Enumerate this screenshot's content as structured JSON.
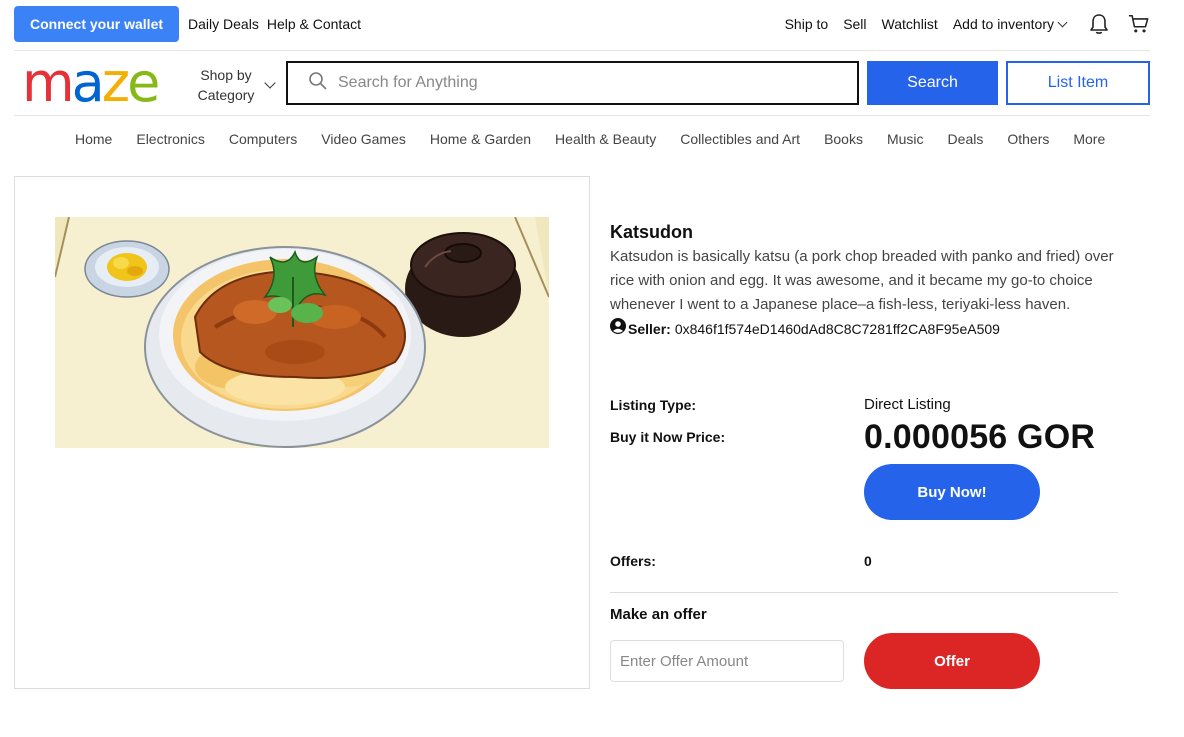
{
  "topbar": {
    "wallet_button": "Connect your wallet",
    "links_left": [
      "Daily Deals",
      "Help & Contact"
    ],
    "ship_to": "Ship to",
    "sell": "Sell",
    "watchlist": "Watchlist",
    "add_inventory": "Add to inventory",
    "icons": [
      "bell-icon",
      "cart-icon"
    ]
  },
  "header": {
    "logo_letters": [
      "m",
      "a",
      "z",
      "e"
    ],
    "logo_colors": [
      "#e53238",
      "#0064d2",
      "#f5af02",
      "#86b817"
    ],
    "shop_by_category": "Shop by Category",
    "search_placeholder": "Search for Anything",
    "search_button": "Search",
    "list_item_button": "List Item"
  },
  "nav": {
    "categories": [
      "Home",
      "Electronics",
      "Computers",
      "Video Games",
      "Home & Garden",
      "Health & Beauty",
      "Collectibles and Art",
      "Books",
      "Music",
      "Deals",
      "Others",
      "More"
    ]
  },
  "product": {
    "title": "Katsudon",
    "description": "Katsudon is basically katsu (a pork chop breaded with panko and fried) over rice with onion and egg. It was awesome, and it became my go-to choice whenever I went to a Japanese place–a fish-less, teriyaki-less haven.",
    "seller_label": "Seller:",
    "seller_address": "0x846f1f574eD1460dAd8C8C7281ff2CA8F95eA509",
    "listing_type_label": "Listing Type:",
    "listing_type": "Direct Listing",
    "price_label": "Buy it Now Price:",
    "price": "0.000056 GOR",
    "buy_button": "Buy Now!",
    "offers_label": "Offers:",
    "offers_count": "0",
    "make_offer_label": "Make an offer",
    "offer_placeholder": "Enter Offer Amount",
    "offer_button": "Offer"
  },
  "colors": {
    "primary": "#2563eb",
    "wallet": "#3b82f6",
    "offer": "#dc2626"
  }
}
